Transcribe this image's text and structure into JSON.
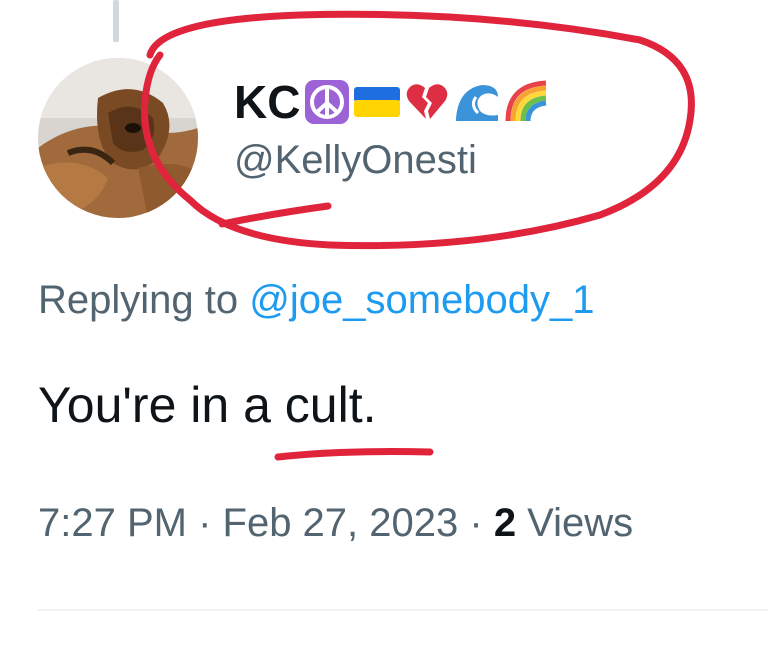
{
  "profile": {
    "display_name": "KC",
    "handle": "@KellyOnesti",
    "name_emojis": [
      "peace-symbol-icon",
      "ukraine-flag-icon",
      "broken-heart-icon",
      "blue-wave-icon",
      "rainbow-icon"
    ]
  },
  "reply": {
    "prefix": "Replying to ",
    "mention": "@joe_somebody_1"
  },
  "tweet": {
    "text": "You're in a cult."
  },
  "meta": {
    "time": "7:27 PM",
    "separator": " · ",
    "date": "Feb 27, 2023",
    "views_count": "2",
    "views_label": " Views"
  },
  "colors": {
    "primary_text": "#0f1419",
    "secondary_text": "#536471",
    "link": "#1d9bf0",
    "annotation_red": "#e0243c"
  }
}
